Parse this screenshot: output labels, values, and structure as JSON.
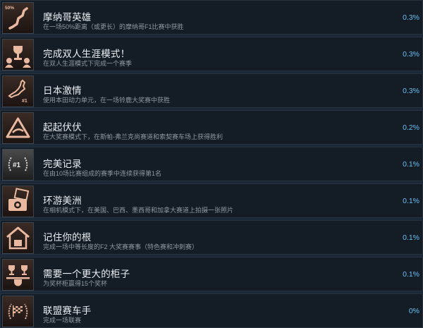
{
  "achievements": [
    {
      "title": "摩纳哥英雄",
      "description": "在一场50%距离（或更长）的摩纳哥F1比赛中获胜",
      "percent": "0.3%",
      "icon": "monaco-track-icon",
      "badge": "50%"
    },
    {
      "title": "完成双人生涯模式！",
      "description": "在双人生涯模式下完成一个赛季",
      "percent": "0.3%",
      "icon": "two-player-trophy-icon"
    },
    {
      "title": "日本激情",
      "description": "使用本田动力单元，在一场铃鹿大奖赛中获胜",
      "percent": "0.3%",
      "icon": "japan-map-icon",
      "badge": "#1"
    },
    {
      "title": "起起伏伏",
      "description": "在大奖赛模式下，在斯帕-弗兰克尚赛道和索契赛车场上获得胜利",
      "percent": "0.2%",
      "icon": "warning-triangle-icon"
    },
    {
      "title": "完美记录",
      "description": "在由10场比赛组成的赛季中连续获得第1名",
      "percent": "0.1%",
      "icon": "laurel-number-one-icon",
      "badge": "#1"
    },
    {
      "title": "环游美洲",
      "description": "在相机模式下，在美国、巴西、墨西哥和加拿大赛道上拍摄一张照片",
      "percent": "0.1%",
      "icon": "camera-photos-icon"
    },
    {
      "title": "记住你的根",
      "description": "完成一场中等长度的F2 大奖赛赛事（特色赛和冲刺赛）",
      "percent": "0.1%",
      "icon": "home-f2-icon"
    },
    {
      "title": "需要一个更大的柜子",
      "description": "为奖杯柜赢得15个奖杯",
      "percent": "0.1%",
      "icon": "trophy-cabinet-icon"
    },
    {
      "title": "联盟赛车手",
      "description": "完成一场联赛",
      "percent": "0%",
      "icon": "laurel-flag-icon"
    }
  ]
}
